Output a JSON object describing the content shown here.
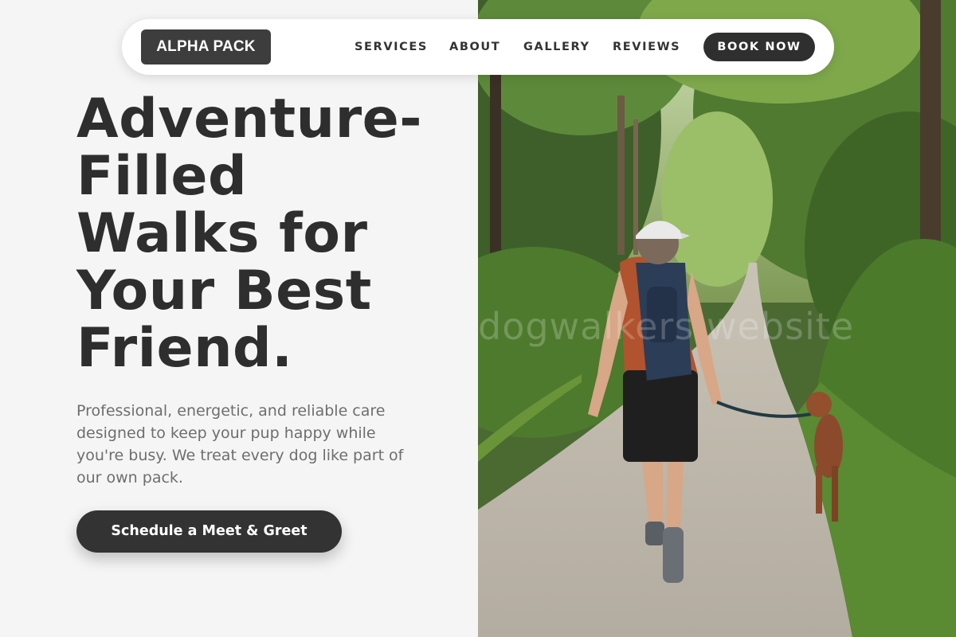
{
  "nav": {
    "logo": "ALPHA PACK",
    "links": [
      "SERVICES",
      "ABOUT",
      "GALLERY",
      "REVIEWS"
    ],
    "book_label": "BOOK NOW"
  },
  "hero": {
    "headline_lines": [
      "Adventure-",
      "Filled",
      "Walks for",
      "Your Best",
      "Friend."
    ],
    "subtext": "Professional, energetic, and reliable care designed to keep your pup happy while you're busy. We treat every dog like part of our own pack.",
    "cta_label": "Schedule a Meet & Greet"
  },
  "photo": {
    "watermark": "dogwalkers website"
  },
  "colors": {
    "primary_dark": "#333333",
    "background": "#f5f5f5",
    "text_muted": "#6e6e6e"
  }
}
